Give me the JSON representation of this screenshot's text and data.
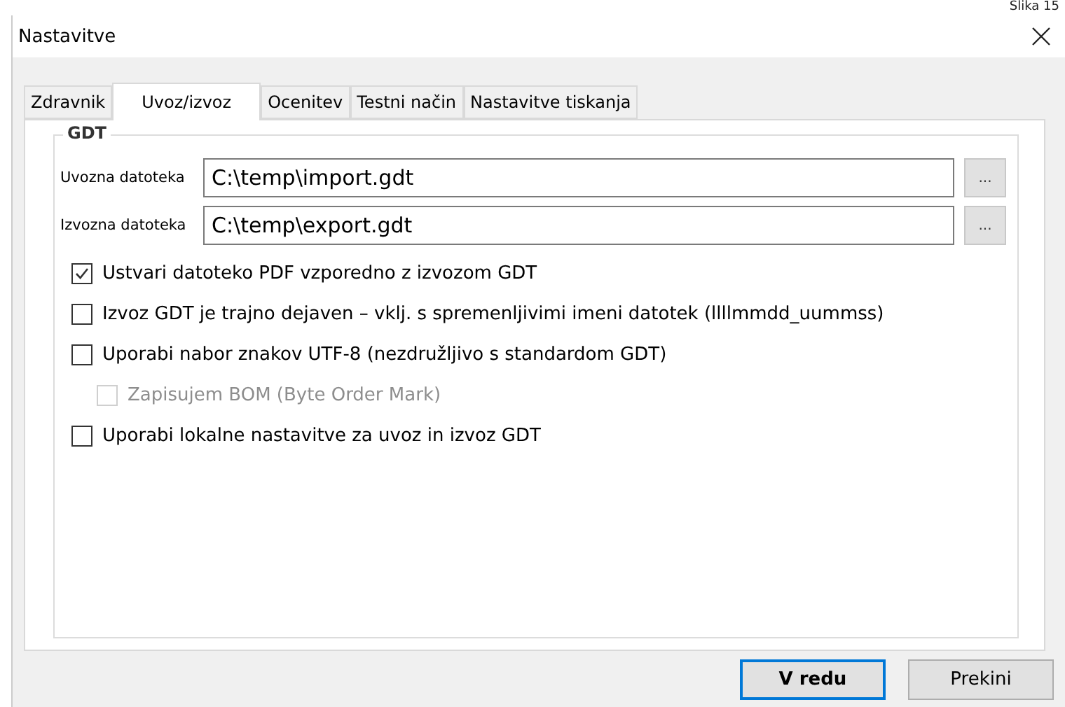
{
  "figure_label": "Slika 15",
  "window": {
    "title": "Nastavitve"
  },
  "tabs": [
    {
      "label": "Zdravnik",
      "selected": false
    },
    {
      "label": "Uvoz/izvoz",
      "selected": true
    },
    {
      "label": "Ocenitev",
      "selected": false
    },
    {
      "label": "Testni način",
      "selected": false
    },
    {
      "label": "Nastavitve tiskanja",
      "selected": false
    }
  ],
  "group": {
    "title": "GDT",
    "fields": [
      {
        "label": "Uvozna datoteka",
        "value": "C:\\temp\\import.gdt",
        "browse": "..."
      },
      {
        "label": "Izvozna datoteka",
        "value": "C:\\temp\\export.gdt",
        "browse": "..."
      }
    ],
    "options": [
      {
        "label": "Ustvari datoteko PDF vzporedno z izvozom GDT",
        "checked": true,
        "disabled": false
      },
      {
        "label": "Izvoz GDT je trajno dejaven – vklj. s spremenljivimi imeni datotek (llllmmdd_uummss)",
        "checked": false,
        "disabled": false
      },
      {
        "label": "Uporabi nabor znakov UTF-8 (nezdružljivo s standardom GDT)",
        "checked": false,
        "disabled": false,
        "children": [
          {
            "label": "Zapisujem BOM (Byte Order Mark)",
            "checked": false,
            "disabled": true
          }
        ]
      },
      {
        "label": "Uporabi lokalne nastavitve za uvoz in izvoz GDT",
        "checked": false,
        "disabled": false
      }
    ]
  },
  "buttons": [
    {
      "label": "V redu",
      "default": true
    },
    {
      "label": "Prekini",
      "default": false
    }
  ]
}
